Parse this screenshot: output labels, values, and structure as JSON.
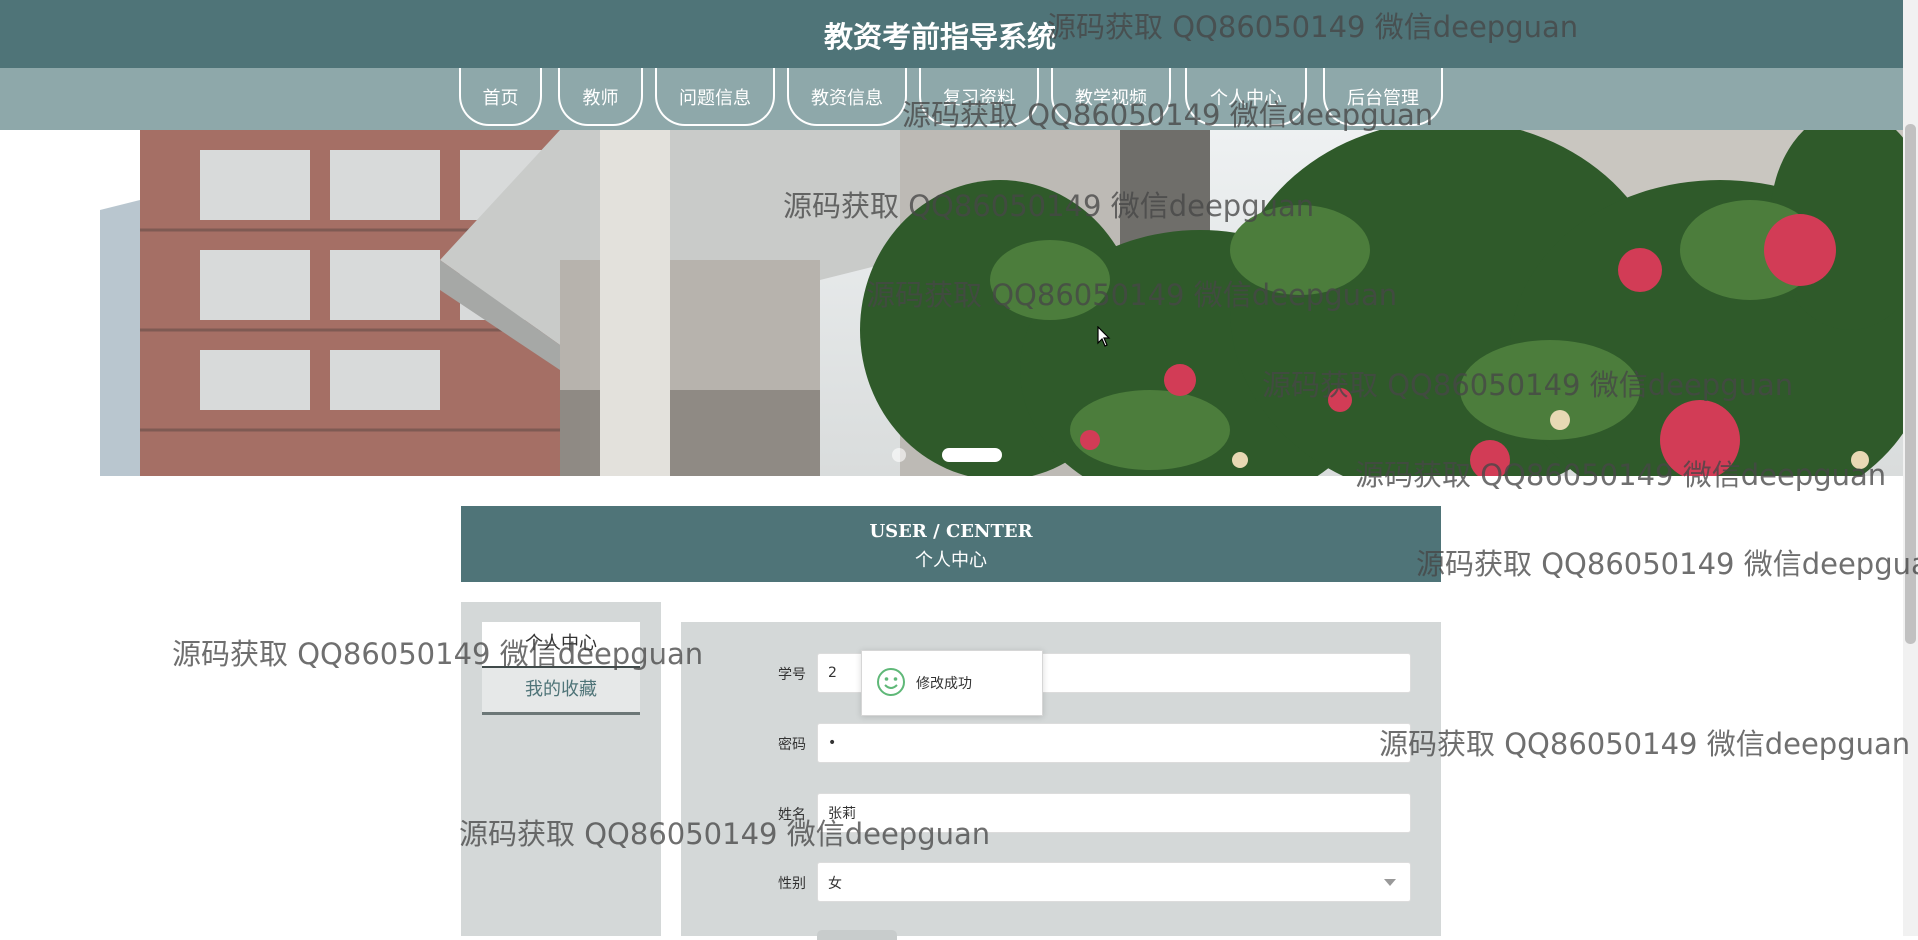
{
  "site": {
    "title": "教资考前指导系统"
  },
  "nav": {
    "items": [
      {
        "label": "首页"
      },
      {
        "label": "教师"
      },
      {
        "label": "问题信息"
      },
      {
        "label": "教资信息"
      },
      {
        "label": "复习资料"
      },
      {
        "label": "教学视频"
      },
      {
        "label": "个人中心"
      },
      {
        "label": "后台管理"
      }
    ]
  },
  "banner": {
    "slide_count": 2,
    "active_slide": 2
  },
  "section": {
    "title_en": "USER / CENTER",
    "title_cn": "个人中心"
  },
  "sidebar": {
    "items": [
      {
        "label": "个人中心",
        "active": true
      },
      {
        "label": "我的收藏",
        "active": false
      }
    ]
  },
  "form": {
    "student_id": {
      "label": "学号",
      "value": "2"
    },
    "password": {
      "label": "密码",
      "value": "•"
    },
    "name": {
      "label": "姓名",
      "value": "张莉"
    },
    "gender": {
      "label": "性别",
      "value": "女"
    }
  },
  "toast": {
    "message": "修改成功",
    "icon": "smile-icon"
  },
  "watermark": {
    "text": "源码获取 QQ86050149 微信deepguan"
  },
  "colors": {
    "primary": "#4f7478",
    "nav_bg": "#8ea8aa",
    "panel_bg": "#d4d8d8"
  }
}
